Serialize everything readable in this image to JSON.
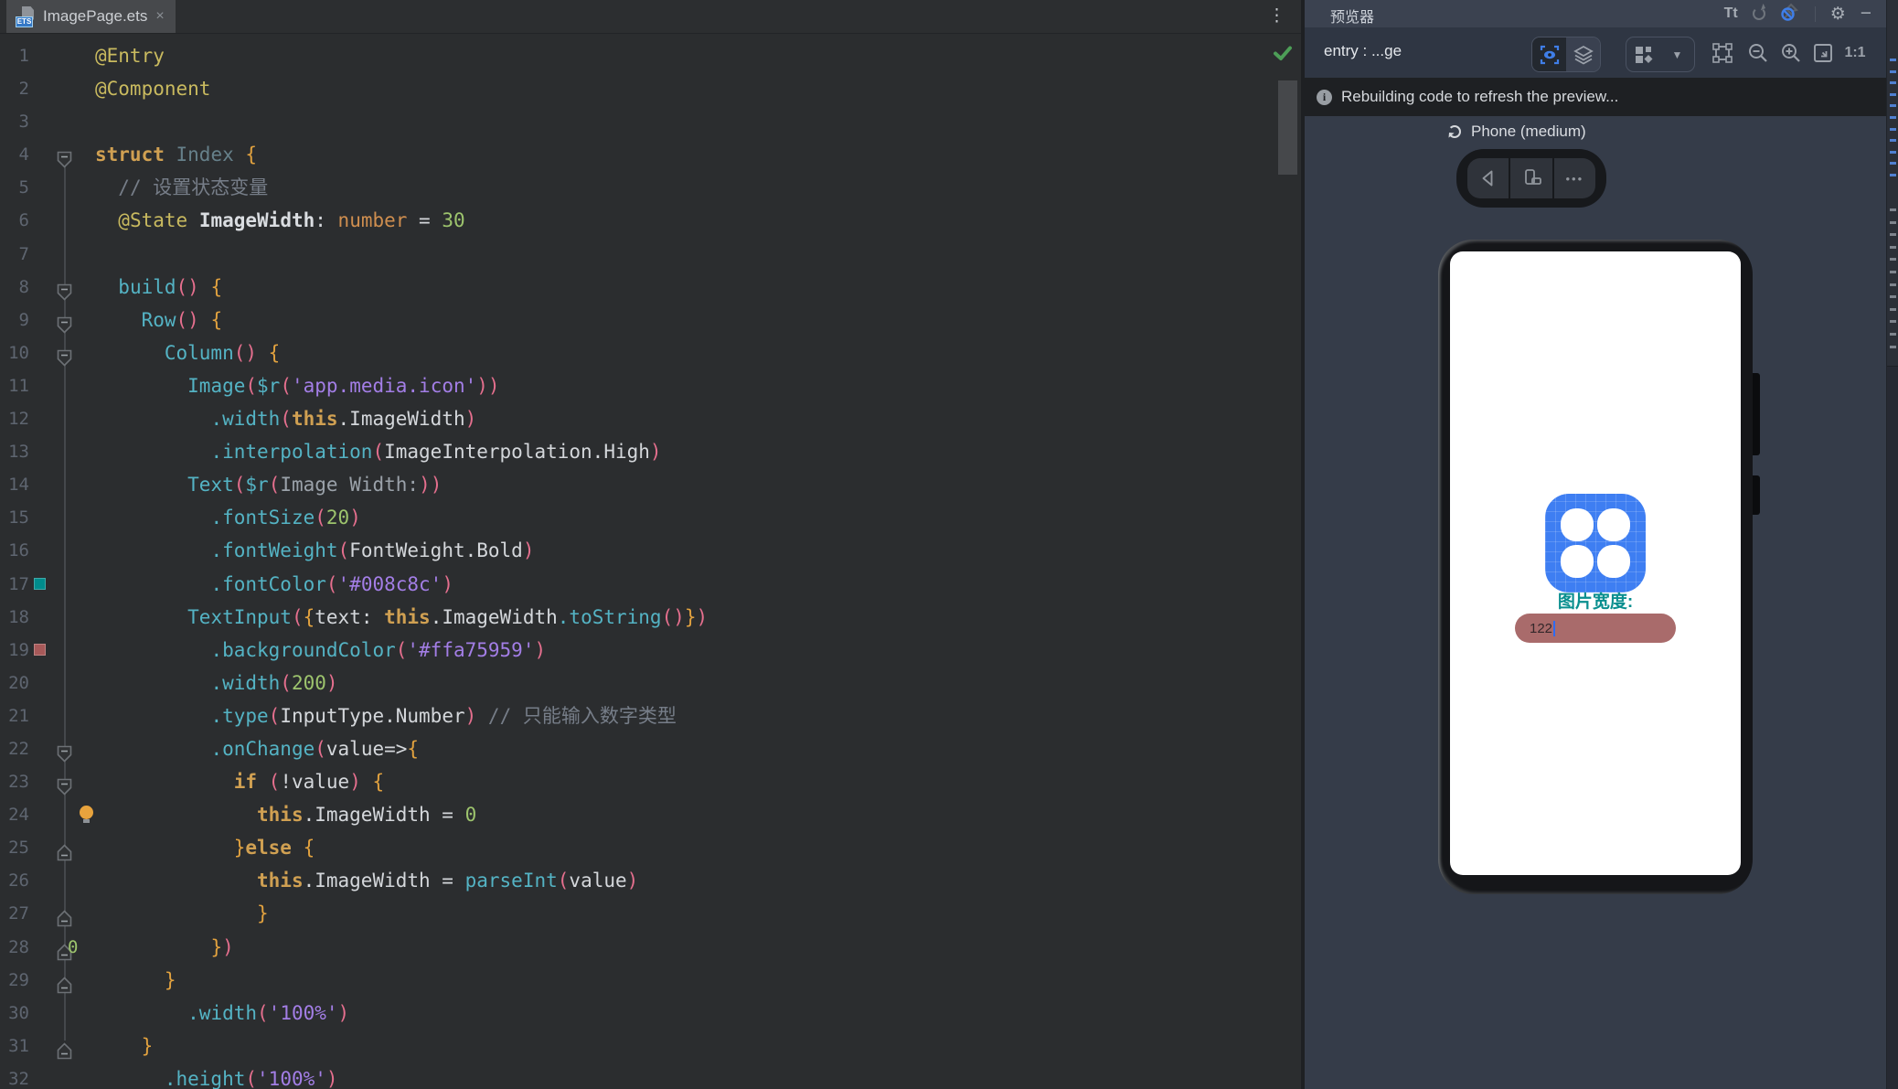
{
  "tab": {
    "title": "ImagePage.ets",
    "file_badge": "ETS"
  },
  "icons": {
    "close": "×",
    "kebab": "⋮",
    "font_size": "Tt",
    "settings": "⚙",
    "minimize": "−",
    "caret_down": "▼",
    "more_dots": "•••",
    "zoom_ratio": "1:1"
  },
  "editor": {
    "status": "no-errors-checkmark",
    "lines": [
      {
        "n": 1,
        "t": [
          [
            "d",
            "@Entry"
          ]
        ]
      },
      {
        "n": 2,
        "t": [
          [
            "d",
            "@Component"
          ]
        ]
      },
      {
        "n": 3,
        "t": []
      },
      {
        "n": 4,
        "f": "s",
        "t": [
          [
            "k",
            "struct"
          ],
          [
            "w",
            " "
          ],
          [
            "t",
            "Index"
          ],
          [
            "w",
            " "
          ],
          [
            "b",
            "{"
          ]
        ]
      },
      {
        "n": 5,
        "t": [
          [
            "w",
            "  "
          ],
          [
            "c",
            "// 设置状态变量"
          ]
        ]
      },
      {
        "n": 6,
        "t": [
          [
            "w",
            "  "
          ],
          [
            "d",
            "@State"
          ],
          [
            "w",
            " "
          ],
          [
            "wb",
            "ImageWidth"
          ],
          [
            "w",
            ": "
          ],
          [
            "k2",
            "number"
          ],
          [
            "w",
            " = "
          ],
          [
            "n2",
            "30"
          ]
        ]
      },
      {
        "n": 7,
        "t": []
      },
      {
        "n": 8,
        "f": "s",
        "t": [
          [
            "w",
            "  "
          ],
          [
            "f2",
            "build"
          ],
          [
            "p",
            "()"
          ],
          [
            "w",
            " "
          ],
          [
            "b",
            "{"
          ]
        ]
      },
      {
        "n": 9,
        "f": "s",
        "t": [
          [
            "w",
            "    "
          ],
          [
            "f2",
            "Row"
          ],
          [
            "p",
            "()"
          ],
          [
            "w",
            " "
          ],
          [
            "b",
            "{"
          ]
        ]
      },
      {
        "n": 10,
        "f": "s",
        "t": [
          [
            "w",
            "      "
          ],
          [
            "f2",
            "Column"
          ],
          [
            "p",
            "()"
          ],
          [
            "w",
            " "
          ],
          [
            "b",
            "{"
          ]
        ]
      },
      {
        "n": 11,
        "t": [
          [
            "w",
            "        "
          ],
          [
            "f2",
            "Image"
          ],
          [
            "p",
            "("
          ],
          [
            "f2",
            "$r"
          ],
          [
            "p",
            "("
          ],
          [
            "s",
            "'app.media.icon'"
          ],
          [
            "p",
            "))"
          ]
        ]
      },
      {
        "n": 12,
        "t": [
          [
            "w",
            "          "
          ],
          [
            "f2",
            ".width"
          ],
          [
            "p",
            "("
          ],
          [
            "k",
            "this"
          ],
          [
            "w",
            ".ImageWidth"
          ],
          [
            "p",
            ")"
          ]
        ]
      },
      {
        "n": 13,
        "t": [
          [
            "w",
            "          "
          ],
          [
            "f2",
            ".interpolation"
          ],
          [
            "p",
            "("
          ],
          [
            "w",
            "ImageInterpolation.High"
          ],
          [
            "p",
            ")"
          ]
        ]
      },
      {
        "n": 14,
        "t": [
          [
            "w",
            "        "
          ],
          [
            "f2",
            "Text"
          ],
          [
            "p",
            "("
          ],
          [
            "f2",
            "$r"
          ],
          [
            "p",
            "("
          ],
          [
            "g",
            "Image Width:"
          ],
          [
            "p",
            "))"
          ]
        ]
      },
      {
        "n": 15,
        "t": [
          [
            "w",
            "          "
          ],
          [
            "f2",
            ".fontSize"
          ],
          [
            "p",
            "("
          ],
          [
            "n2",
            "20"
          ],
          [
            "p",
            ")"
          ]
        ]
      },
      {
        "n": 16,
        "t": [
          [
            "w",
            "          "
          ],
          [
            "f2",
            ".fontWeight"
          ],
          [
            "p",
            "("
          ],
          [
            "w",
            "FontWeight.Bold"
          ],
          [
            "p",
            ")"
          ]
        ]
      },
      {
        "n": 17,
        "sw": "#008c8c",
        "t": [
          [
            "w",
            "          "
          ],
          [
            "f2",
            ".fontColor"
          ],
          [
            "p",
            "("
          ],
          [
            "s",
            "'#008c8c'"
          ],
          [
            "p",
            ")"
          ]
        ]
      },
      {
        "n": 18,
        "t": [
          [
            "w",
            "        "
          ],
          [
            "f2",
            "TextInput"
          ],
          [
            "p",
            "("
          ],
          [
            "b",
            "{"
          ],
          [
            "w",
            "text: "
          ],
          [
            "k",
            "this"
          ],
          [
            "w",
            ".ImageWidth"
          ],
          [
            "f2",
            ".toString"
          ],
          [
            "p",
            "()"
          ],
          [
            "b",
            "}"
          ],
          [
            "p",
            ")"
          ]
        ]
      },
      {
        "n": 19,
        "sw": "#a75959",
        "t": [
          [
            "w",
            "          "
          ],
          [
            "f2",
            ".backgroundColor"
          ],
          [
            "p",
            "("
          ],
          [
            "s",
            "'#ffa75959'"
          ],
          [
            "p",
            ")"
          ]
        ]
      },
      {
        "n": 20,
        "t": [
          [
            "w",
            "          "
          ],
          [
            "f2",
            ".width"
          ],
          [
            "p",
            "("
          ],
          [
            "n2",
            "200"
          ],
          [
            "p",
            ")"
          ]
        ]
      },
      {
        "n": 21,
        "t": [
          [
            "w",
            "          "
          ],
          [
            "f2",
            ".type"
          ],
          [
            "p",
            "("
          ],
          [
            "w",
            "InputType.Number"
          ],
          [
            "p",
            ")"
          ],
          [
            "w",
            " "
          ],
          [
            "c",
            "// 只能输入数字类型"
          ]
        ]
      },
      {
        "n": 22,
        "f": "s",
        "t": [
          [
            "w",
            "          "
          ],
          [
            "f2",
            ".onChange"
          ],
          [
            "p",
            "("
          ],
          [
            "w",
            "value=>"
          ],
          [
            "b",
            "{"
          ]
        ]
      },
      {
        "n": 23,
        "f": "s",
        "t": [
          [
            "w",
            "            "
          ],
          [
            "k",
            "if"
          ],
          [
            "w",
            " "
          ],
          [
            "p",
            "("
          ],
          [
            "w",
            "!value"
          ],
          [
            "p",
            ")"
          ],
          [
            "w",
            " "
          ],
          [
            "b",
            "{"
          ]
        ]
      },
      {
        "n": 24,
        "bulb": true,
        "t": [
          [
            "w",
            "              "
          ],
          [
            "k",
            "this"
          ],
          [
            "w",
            ".ImageWidth = "
          ],
          [
            "n2",
            "0"
          ]
        ]
      },
      {
        "n": 25,
        "f": "e",
        "t": [
          [
            "w",
            "            "
          ],
          [
            "b",
            "}"
          ],
          [
            "k",
            "else"
          ],
          [
            "w",
            " "
          ],
          [
            "b",
            "{"
          ]
        ]
      },
      {
        "n": 26,
        "t": [
          [
            "w",
            "              "
          ],
          [
            "k",
            "this"
          ],
          [
            "w",
            ".ImageWidth = "
          ],
          [
            "f2",
            "parseInt"
          ],
          [
            "p",
            "("
          ],
          [
            "w",
            "value"
          ],
          [
            "p",
            ")"
          ]
        ]
      },
      {
        "n": 27,
        "f": "e",
        "t": [
          [
            "w",
            "              "
          ],
          [
            "b",
            "}"
          ]
        ]
      },
      {
        "n": 28,
        "f": "e",
        "zero": "0",
        "t": [
          [
            "w",
            "          "
          ],
          [
            "b",
            "}"
          ],
          [
            "p",
            ")"
          ]
        ]
      },
      {
        "n": 29,
        "f": "e",
        "t": [
          [
            "w",
            "      "
          ],
          [
            "b",
            "}"
          ]
        ]
      },
      {
        "n": 30,
        "t": [
          [
            "w",
            "        "
          ],
          [
            "f2",
            ".width"
          ],
          [
            "p",
            "("
          ],
          [
            "s",
            "'100%'"
          ],
          [
            "p",
            ")"
          ]
        ]
      },
      {
        "n": 31,
        "f": "e",
        "t": [
          [
            "w",
            "    "
          ],
          [
            "b",
            "}"
          ]
        ]
      },
      {
        "n": 32,
        "t": [
          [
            "w",
            "      "
          ],
          [
            "f2",
            ".height"
          ],
          [
            "p",
            "("
          ],
          [
            "s",
            "'100%'"
          ],
          [
            "p",
            ")"
          ]
        ]
      }
    ]
  },
  "preview": {
    "panel_title": "预览器",
    "target": "entry : ...ge",
    "notification": "Rebuilding code to refresh the preview...",
    "device_label": "Phone (medium)",
    "screen": {
      "label": "图片宽度:",
      "input_value": "122"
    },
    "colors": {
      "accent_blue": "#3f7ee8",
      "label_teal": "#008c8c",
      "input_pill": "#a96b6b",
      "app_icon_blue": "#3e7ef2"
    }
  }
}
